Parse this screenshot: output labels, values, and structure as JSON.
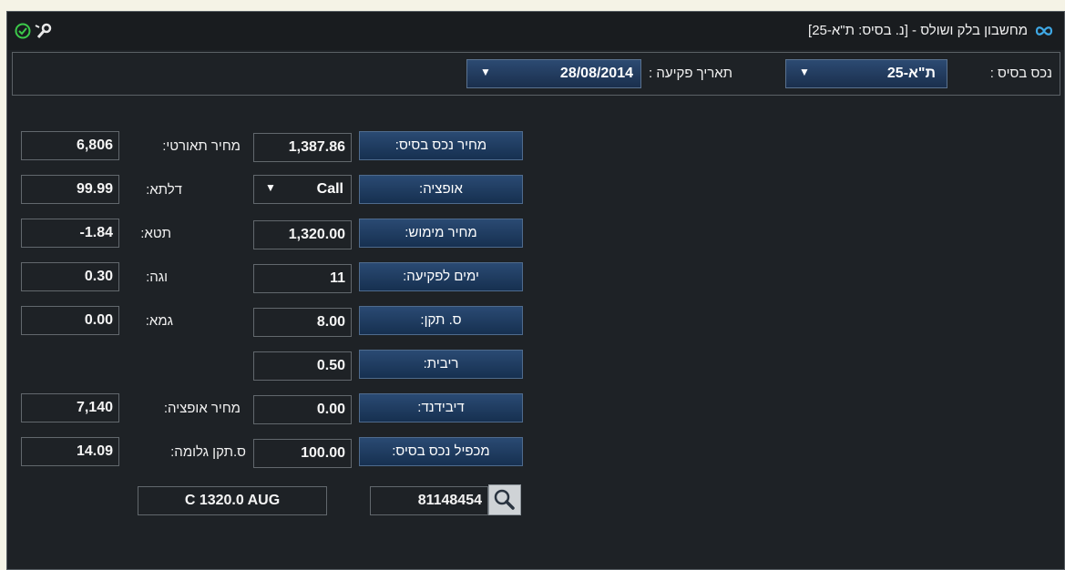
{
  "window": {
    "title": "מחשבון בלק ושולס - [נ. בסיס: ת\"א-25]",
    "app_icon": "infinity-icon",
    "icons": [
      "check-circle-icon",
      "wrench-icon"
    ]
  },
  "selectors": {
    "underlying_label": "נכס בסיס :",
    "underlying_value": "ת\"א-25",
    "expiry_label": "תאריך פקיעה :",
    "expiry_value": "28/08/2014"
  },
  "inputs": [
    {
      "label": "מחיר נכס בסיס:",
      "value": "1,387.86"
    },
    {
      "label": "אופציה:",
      "value": "Call"
    },
    {
      "label": "מחיר מימוש:",
      "value": "1,320.00"
    },
    {
      "label": "ימים לפקיעה:",
      "value": "11"
    },
    {
      "label": "ס. תקן:",
      "value": "8.00"
    },
    {
      "label": "ריבית:",
      "value": "0.50"
    },
    {
      "label": "דיבידנד:",
      "value": "0.00"
    },
    {
      "label": "מכפיל נכס בסיס:",
      "value": "100.00"
    }
  ],
  "outputs": [
    {
      "label": "מחיר תאורטי:",
      "value": "6,806"
    },
    {
      "label": "דלתא:",
      "value": "99.99"
    },
    {
      "label": "תטא:",
      "value": "-1.84"
    },
    {
      "label": "וגה:",
      "value": "0.30"
    },
    {
      "label": "גמא:",
      "value": "0.00"
    },
    {
      "label": "מחיר אופציה:",
      "value": "7,140"
    },
    {
      "label": "ס.תקן גלומה:",
      "value": "14.09"
    }
  ],
  "footer": {
    "option_code": "C 1320.0 AUG",
    "security_number": "81148454",
    "search_icon": "magnifier-icon"
  },
  "colors": {
    "background": "#1e2226",
    "button_blue": "#1a3a63",
    "accent_blue": "#3fa9e6",
    "ok_green": "#3cc94a"
  }
}
